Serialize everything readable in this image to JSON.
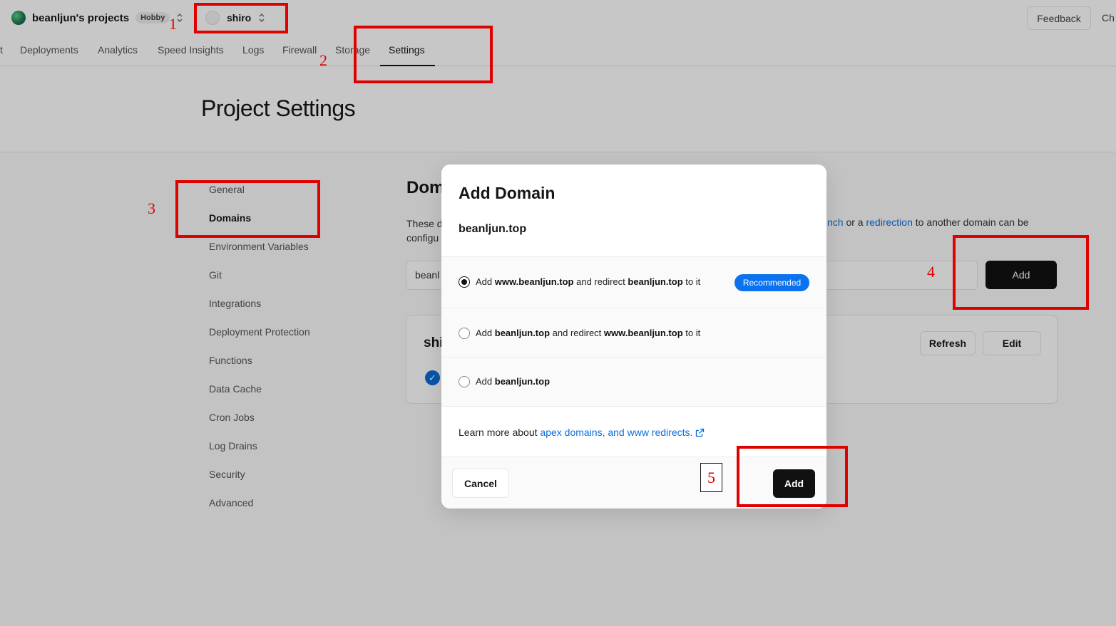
{
  "topbar": {
    "team_name": "beanljun's projects",
    "team_plan": "Hobby",
    "project_name": "shiro",
    "feedback_label": "Feedback",
    "changelog_label": "Ch"
  },
  "tabs": [
    {
      "label": "t"
    },
    {
      "label": "Deployments"
    },
    {
      "label": "Analytics"
    },
    {
      "label": "Speed Insights"
    },
    {
      "label": "Logs"
    },
    {
      "label": "Firewall"
    },
    {
      "label": "Storage"
    },
    {
      "label": "Settings",
      "active": true
    }
  ],
  "page": {
    "title": "Project Settings"
  },
  "sidenav": {
    "items": [
      {
        "label": "General"
      },
      {
        "label": "Domains",
        "active": true
      },
      {
        "label": "Environment Variables"
      },
      {
        "label": "Git"
      },
      {
        "label": "Integrations"
      },
      {
        "label": "Deployment Protection"
      },
      {
        "label": "Functions"
      },
      {
        "label": "Data Cache"
      },
      {
        "label": "Cron Jobs"
      },
      {
        "label": "Log Drains"
      },
      {
        "label": "Security"
      },
      {
        "label": "Advanced"
      }
    ]
  },
  "domains_section": {
    "heading": "Dom",
    "desc_line1": "These d",
    "desc_line2": "configu",
    "desc_right_pre": "nch",
    "desc_right_mid": " or a ",
    "desc_right_link": "redirection",
    "desc_right_post": " to another domain can be",
    "input_value": "beanl",
    "add_label": "Add",
    "card_title": "shi",
    "refresh_label": "Refresh",
    "edit_label": "Edit"
  },
  "modal": {
    "title": "Add Domain",
    "domain": "beanljun.top",
    "options": [
      {
        "pre": "Add ",
        "b1": "www.beanljun.top",
        "mid": " and redirect ",
        "b2": "beanljun.top",
        "post": " to it",
        "selected": true,
        "badge": "Recommended"
      },
      {
        "pre": "Add ",
        "b1": "beanljun.top",
        "mid": " and redirect ",
        "b2": "www.beanljun.top",
        "post": " to it",
        "selected": false
      },
      {
        "pre": "Add ",
        "b1": "beanljun.top",
        "mid": "",
        "b2": "",
        "post": "",
        "selected": false
      }
    ],
    "learn_pre": "Learn more about ",
    "learn_link": "apex domains, and www redirects.",
    "cancel_label": "Cancel",
    "add_label": "Add"
  },
  "annotations": [
    "1",
    "2",
    "3",
    "4",
    "5"
  ],
  "colors": {
    "accent": "#0a72ef",
    "link": "#0a6ddb",
    "annotation": "#e00000",
    "primary_button": "#111111"
  }
}
